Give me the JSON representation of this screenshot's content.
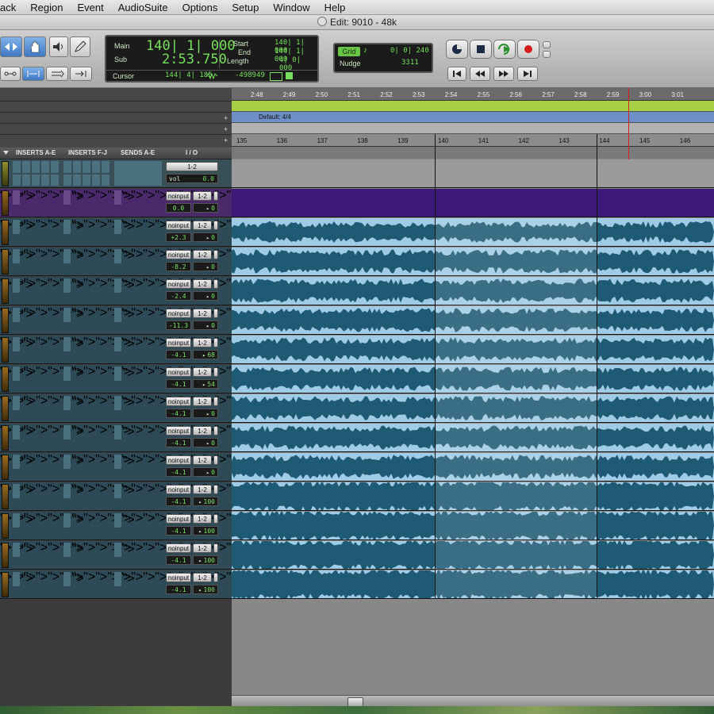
{
  "menubar": {
    "items": [
      "ack",
      "Region",
      "Event",
      "AudioSuite",
      "Options",
      "Setup",
      "Window",
      "Help"
    ]
  },
  "window": {
    "title": "Edit: 9010 - 48k"
  },
  "counter": {
    "main_label": "Main",
    "main_value": "140| 1| 000",
    "sub_label": "Sub",
    "sub_value": "2:53.750",
    "start_label": "Start",
    "start_value": "140| 1| 000",
    "end_label": "End",
    "end_value": "144| 1| 000",
    "length_label": "Length",
    "length_value": "4| 0| 000",
    "cursor_label": "Cursor",
    "cursor_value": "144| 4| 185",
    "cursor_sample": "-498949"
  },
  "grid": {
    "grid_label": "Grid",
    "grid_value": "0| 0| 240",
    "nudge_label": "Nudge",
    "nudge_value": "3311"
  },
  "timecode_ticks": [
    "2:48",
    "2:49",
    "2:50",
    "2:51",
    "2:52",
    "2:53",
    "2:54",
    "2:55",
    "2:56",
    "2:57",
    "2:58",
    "2:59",
    "3:00",
    "3:01"
  ],
  "meter_label": "Default: 4/4",
  "bar_ticks": [
    "135",
    "136",
    "137",
    "138",
    "139",
    "140",
    "141",
    "142",
    "143",
    "144",
    "145",
    "146"
  ],
  "column_headers": {
    "inserts_ae": "INSERTS A-E",
    "inserts_fj": "INSERTS F-J",
    "sends_ae": "SENDS A-E",
    "io": "I / O"
  },
  "master": {
    "output": "1-2",
    "vol_label": "vol",
    "vol_value": "0.0"
  },
  "tracks": [
    {
      "input": "noinput",
      "output": "1-2",
      "vol": "0.0",
      "pan": "0",
      "color": "purple"
    },
    {
      "input": "noinput",
      "output": "1-2",
      "vol": "+2.3",
      "pan": "0",
      "color": "blue"
    },
    {
      "input": "noinput",
      "output": "1-2",
      "vol": "-8.2",
      "pan": "0",
      "color": "blue"
    },
    {
      "input": "noinput",
      "output": "1-2",
      "vol": "-2.4",
      "pan": "0",
      "color": "blue"
    },
    {
      "input": "noinput",
      "output": "1-2",
      "vol": "-11.3",
      "pan": "0",
      "color": "blue"
    },
    {
      "input": "noinput",
      "output": "1-2",
      "vol": "-4.1",
      "pan": "68",
      "color": "blue"
    },
    {
      "input": "noinput",
      "output": "1-2",
      "vol": "-4.1",
      "pan": "54",
      "color": "blue"
    },
    {
      "input": "noinput",
      "output": "1-2",
      "vol": "-4.1",
      "pan": "0",
      "color": "blue"
    },
    {
      "input": "noinput",
      "output": "1-2",
      "vol": "-4.1",
      "pan": "0",
      "color": "blue"
    },
    {
      "input": "noinput",
      "output": "1-2",
      "vol": "-4.1",
      "pan": "0",
      "color": "blue"
    },
    {
      "input": "noinput",
      "output": "1-2",
      "vol": "-4.1",
      "pan": "100",
      "color": "blue"
    },
    {
      "input": "noinput",
      "output": "1-2",
      "vol": "-4.1",
      "pan": "100",
      "color": "blue"
    },
    {
      "input": "noinput",
      "output": "1-2",
      "vol": "-4.1",
      "pan": "100",
      "color": "blue"
    },
    {
      "input": "noinput",
      "output": "1-2",
      "vol": "-4.1",
      "pan": "100",
      "color": "blue"
    }
  ],
  "colors": {
    "waveform_dark": "#1f5a74",
    "waveform_light": "#9fcbe4",
    "selection": "#7fb2d3",
    "purple_clip": "#3d1a78"
  }
}
